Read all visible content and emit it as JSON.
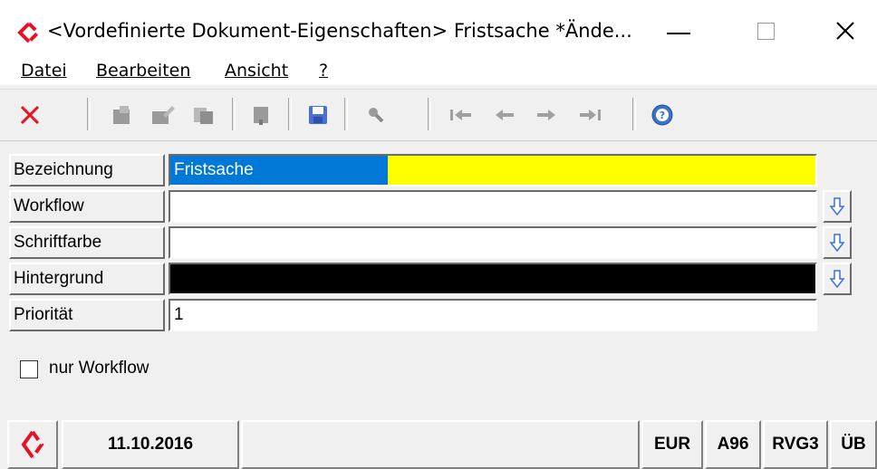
{
  "window": {
    "title": "<Vordefinierte Dokument-Eigenschaften> Fristsache *Ände...",
    "minimize_icon": "minimize-icon",
    "maximize_icon": "maximize-icon",
    "close_icon": "close-icon"
  },
  "menu": {
    "items": [
      {
        "label": "Datei",
        "accel": "D"
      },
      {
        "label": "Bearbeiten",
        "accel": "B"
      },
      {
        "label": "Ansicht",
        "accel": "A"
      },
      {
        "label": "?",
        "accel": "?"
      }
    ]
  },
  "toolbar": {
    "icons": [
      "cancel-x-icon",
      "new-doc-icon",
      "edit-doc-icon",
      "copy-doc-icon",
      "delete-doc-icon",
      "save-icon",
      "search-icon",
      "first-record-icon",
      "prev-record-icon",
      "next-record-icon",
      "last-record-icon",
      "help-icon"
    ]
  },
  "form": {
    "bezeichnung": {
      "label": "Bezeichnung",
      "value": "Fristsache"
    },
    "workflow": {
      "label": "Workflow",
      "value": ""
    },
    "schriftfarbe": {
      "label": "Schriftfarbe",
      "value": ""
    },
    "hintergrund": {
      "label": "Hintergrund",
      "value": ""
    },
    "prioritaet": {
      "label": "Priorität",
      "value": "1"
    },
    "nur_workflow": {
      "label": "nur Workflow",
      "checked": false
    }
  },
  "statusbar": {
    "date": "11.10.2016",
    "message": "",
    "currency": "EUR",
    "code1": "A96",
    "code2": "RVG3",
    "code3": "ÜB"
  },
  "colors": {
    "selection": "#0078d7",
    "highlight_field": "#ffff00",
    "background_swatch": "#000000",
    "cancel_red": "#e81123",
    "logo_red": "#e81123"
  }
}
